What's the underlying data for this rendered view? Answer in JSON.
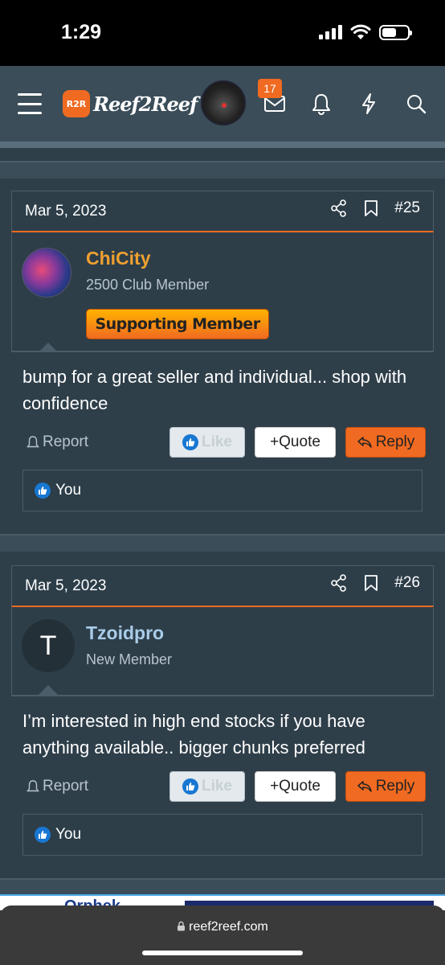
{
  "status_bar": {
    "time": "1:29"
  },
  "nav": {
    "logo_text": "Reef2Reef",
    "logo_badge": "R2R",
    "inbox_count": "17"
  },
  "posts": [
    {
      "date": "Mar 5, 2023",
      "number": "#25",
      "username": "ChiCity",
      "username_color": "#f0a030",
      "user_title": "2500 Club Member",
      "user_badge": "Supporting Member",
      "body": "bump for a great seller and individual... shop with confidence",
      "report_label": "Report",
      "like_label": "Like",
      "quote_label": "+Quote",
      "reply_label": "Reply",
      "reaction_text": "You"
    },
    {
      "date": "Mar 5, 2023",
      "number": "#26",
      "username": "Tzoidpro",
      "username_color": "#a9cce8",
      "user_title": "New Member",
      "avatar_letter": "T",
      "body": "I’m interested in high end stocks if you have anything available.. bigger chunks preferred",
      "report_label": "Report",
      "like_label": "Like",
      "quote_label": "+Quote",
      "reply_label": "Reply",
      "reaction_text": "You"
    }
  ],
  "banner": {
    "text": "Orphek"
  },
  "browser": {
    "url": "reef2reef.com"
  },
  "colors": {
    "accent": "#f06a21",
    "like_blue": "#1877d2",
    "background": "#2f3f4a"
  }
}
